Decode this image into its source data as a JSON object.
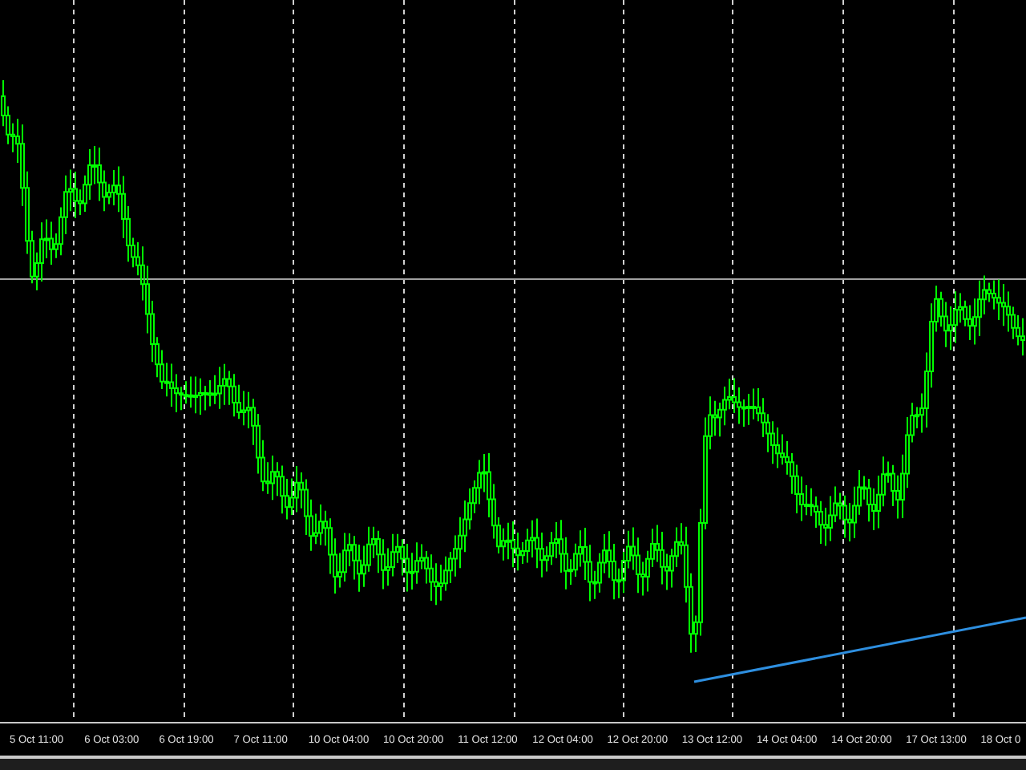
{
  "time_axis": {
    "labels": [
      "5 Oct 11:00",
      "6 Oct 03:00",
      "6 Oct 19:00",
      "7 Oct 11:00",
      "10 Oct 04:00",
      "10 Oct 20:00",
      "11 Oct 12:00",
      "12 Oct 04:00",
      "12 Oct 20:00",
      "13 Oct 12:00",
      "14 Oct 04:00",
      "14 Oct 20:00",
      "17 Oct 13:00",
      "18 Oct 0"
    ]
  }
}
